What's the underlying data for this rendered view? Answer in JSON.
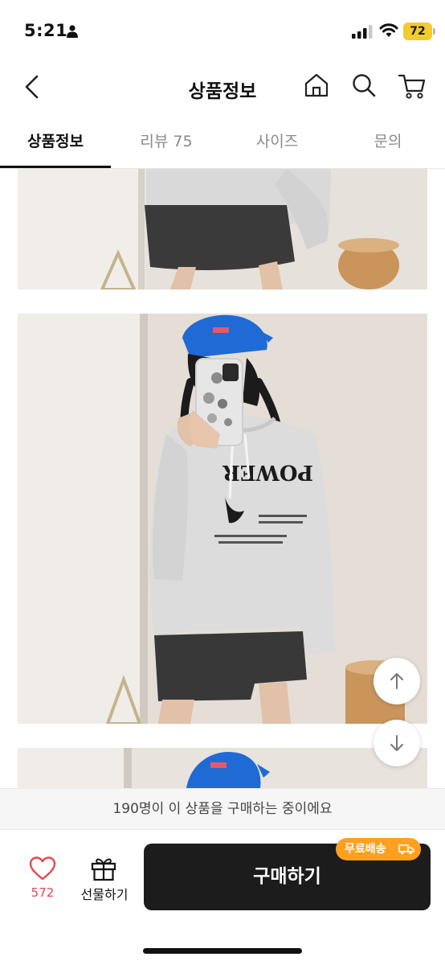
{
  "status_bar": {
    "time": "5:21",
    "battery": "72"
  },
  "header": {
    "title": "상품정보"
  },
  "tabs": [
    {
      "label": "상품정보",
      "active": true
    },
    {
      "label": "리뷰 75",
      "active": false
    },
    {
      "label": "사이즈",
      "active": false
    },
    {
      "label": "문의",
      "active": false
    }
  ],
  "product_images": {
    "hoodie_print_text": "POWER"
  },
  "notice": {
    "text": "190명이 이 상품을 구매하는 중이에요"
  },
  "bottom_bar": {
    "like_count": "572",
    "gift_label": "선물하기",
    "buy_label": "구매하기",
    "free_shipping_badge": "무료배송"
  },
  "colors": {
    "accent_like": "#e8464f",
    "free_shipping_orange": "#ffa020",
    "buy_button_bg": "#1c1c1c",
    "battery_yellow": "#f2cb2e"
  }
}
